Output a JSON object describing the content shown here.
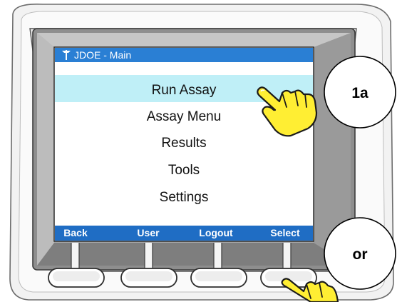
{
  "screen": {
    "title": "JDOE - Main",
    "title_icon": "antenna-icon",
    "selected_index": 0,
    "menu_items": [
      {
        "label": "Run Assay"
      },
      {
        "label": "Assay Menu"
      },
      {
        "label": "Results"
      },
      {
        "label": "Tools"
      },
      {
        "label": "Settings"
      }
    ]
  },
  "softkeys": [
    {
      "label": "Back"
    },
    {
      "label": "User"
    },
    {
      "label": "Logout"
    },
    {
      "label": "Select"
    }
  ],
  "callouts": [
    {
      "label": "1a"
    },
    {
      "label": "or"
    }
  ],
  "colors": {
    "title_bar": "#2a7fd4",
    "softkey_bar": "#1f6dc4",
    "highlight": "#bfeff7",
    "hand_fill": "#ffee33",
    "bezel_outer": "#eeeeee",
    "bezel_inner": "#5a5a5a"
  }
}
